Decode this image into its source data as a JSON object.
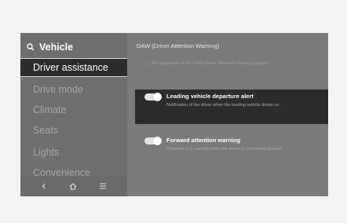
{
  "sidebar": {
    "header_label": "Vehicle",
    "header_icon": "search-icon",
    "items": [
      {
        "label": "Driver assistance",
        "active": true
      },
      {
        "label": "Drive mode",
        "active": false
      },
      {
        "label": "Climate",
        "active": false
      },
      {
        "label": "Seats",
        "active": false
      },
      {
        "label": "Lights",
        "active": false
      },
      {
        "label": "Convenience",
        "active": false
      }
    ],
    "bottom_icons": [
      "back-icon",
      "home-icon",
      "menu-icon"
    ]
  },
  "main": {
    "title": "DAW (Driver Attention Warning)",
    "description": "The properties of the DAW (Driver Attention Warning) system.",
    "options": [
      {
        "title": "Leading vehicle departure alert",
        "description": "Notification of the driver when the leading vehicle drives on.",
        "enabled": true,
        "highlighted": true
      },
      {
        "title": "Forward attention warning",
        "description": "Provision of a warning when the driver is not looking forward",
        "enabled": true,
        "highlighted": false
      }
    ]
  },
  "colors": {
    "screen_bg": "#7a7a7a",
    "highlight_bg": "#2c2c2c",
    "page_bg": "#f3f3f3"
  }
}
